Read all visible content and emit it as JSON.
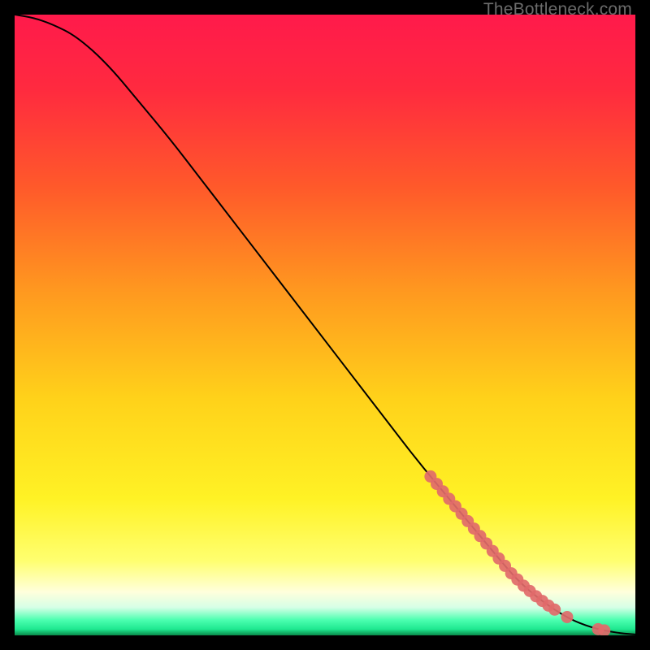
{
  "watermark": "TheBottleneck.com",
  "chart_data": {
    "type": "line",
    "title": "",
    "xlabel": "",
    "ylabel": "",
    "xlim": [
      0,
      100
    ],
    "ylim": [
      0,
      100
    ],
    "background_gradient": {
      "stops": [
        {
          "offset": 0.0,
          "color": "#ff1a4b"
        },
        {
          "offset": 0.12,
          "color": "#ff2a3f"
        },
        {
          "offset": 0.28,
          "color": "#ff5a2a"
        },
        {
          "offset": 0.45,
          "color": "#ff9a1f"
        },
        {
          "offset": 0.62,
          "color": "#ffd21a"
        },
        {
          "offset": 0.78,
          "color": "#fff225"
        },
        {
          "offset": 0.88,
          "color": "#ffff70"
        },
        {
          "offset": 0.93,
          "color": "#ffffdc"
        },
        {
          "offset": 0.955,
          "color": "#d6ffe6"
        },
        {
          "offset": 0.975,
          "color": "#4dffb0"
        },
        {
          "offset": 0.99,
          "color": "#1fe890"
        },
        {
          "offset": 1.0,
          "color": "#0a8a4a"
        }
      ]
    },
    "series": [
      {
        "name": "bottleneck-curve",
        "note": "Estimated from pixel positions; axes are unlabelled so values are in 0-100 relative units (x = horizontal %, y = vertical % from bottom).",
        "x": [
          0,
          3,
          6,
          10,
          15,
          20,
          25,
          30,
          35,
          40,
          45,
          50,
          55,
          60,
          65,
          70,
          75,
          80,
          82,
          84,
          86,
          88,
          90,
          92,
          94,
          96,
          98,
          100
        ],
        "y": [
          100,
          99.5,
          98.5,
          96.5,
          92,
          86,
          80,
          73.5,
          67,
          60.5,
          54,
          47.5,
          41,
          34.5,
          28,
          22,
          16,
          10,
          8,
          6.3,
          4.8,
          3.5,
          2.4,
          1.6,
          1.0,
          0.6,
          0.3,
          0.15
        ]
      }
    ],
    "highlight_points": {
      "name": "highlight-dots",
      "color": "#e16a6a",
      "note": "Dots lie on the curve near the lower-right; x in relative units.",
      "x": [
        67,
        68,
        69,
        70,
        71,
        72,
        73,
        74,
        75,
        76,
        77,
        78,
        79,
        80,
        81,
        82,
        83,
        84,
        85,
        86,
        87,
        89,
        94,
        95
      ]
    }
  }
}
